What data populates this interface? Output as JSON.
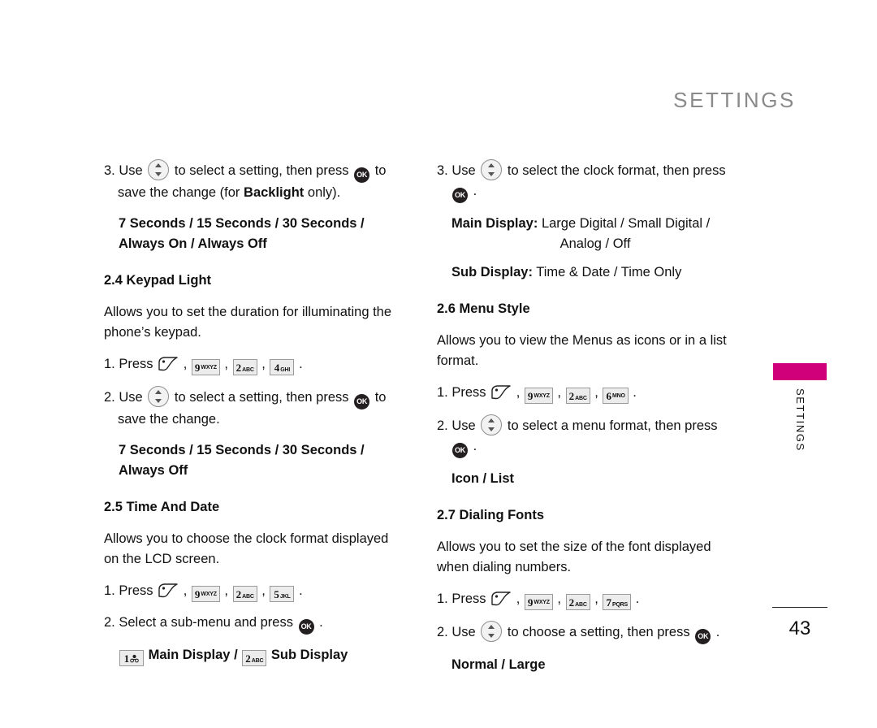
{
  "header": {
    "title": "SETTINGS"
  },
  "side_tab": {
    "label": "SETTINGS",
    "color": "#cf0079"
  },
  "footer": {
    "page_number": "43"
  },
  "icons": {
    "nav_key": "up-down-navigation-key-icon",
    "ok_key": "ok-key-icon",
    "smart_key": "smart-send-key-icon",
    "key_1": "keypad-1-voicemail-key-icon",
    "key_2": "keypad-2-abc-key-icon",
    "key_4": "keypad-4-ghi-key-icon",
    "key_5": "keypad-5-jkl-key-icon",
    "key_6": "keypad-6-mno-key-icon",
    "key_7": "keypad-7-pqrs-key-icon",
    "key_9": "keypad-9-wxyz-key-icon",
    "ok_label": "OK"
  },
  "keys": {
    "k1": {
      "num": "1",
      "sub": ""
    },
    "k2": {
      "num": "2",
      "sub": "ABC"
    },
    "k4": {
      "num": "4",
      "sub": "GHI"
    },
    "k5": {
      "num": "5",
      "sub": "JKL"
    },
    "k6": {
      "num": "6",
      "sub": "MNO"
    },
    "k7": {
      "num": "7",
      "sub": "PQRS"
    },
    "k9": {
      "num": "9",
      "sub": "WXYZ"
    }
  },
  "left_column": {
    "step3_a": "3. Use",
    "step3_b": "to select a setting, then press",
    "step3_c": "to",
    "step3_d": "save the change (for",
    "step3_bold": "Backlight",
    "step3_e": "only).",
    "backlight_options_line1": "7 Seconds / 15 Seconds / 30 Seconds /",
    "backlight_options_line2": "Always On / Always Off",
    "section_24_title": "2.4 Keypad Light",
    "section_24_desc": "Allows you to set the duration for illuminating the phone’s keypad.",
    "s24_step1": "1. Press",
    "s24_step2_a": "2. Use",
    "s24_step2_b": "to select a setting, then press",
    "s24_step2_c": "to",
    "s24_step2_d": "save the change.",
    "keypad_options_line1": "7 Seconds / 15 Seconds / 30 Seconds /",
    "keypad_options_line2": "Always Off",
    "section_25_title": "2.5 Time And Date",
    "section_25_desc": "Allows you to choose the clock format displayed on the LCD screen.",
    "s25_step1": "1. Press",
    "s25_step2_a": "2. Select a sub-menu and press",
    "s25_main_display": "Main Display",
    "s25_slash": "/",
    "s25_sub_display": "Sub Display",
    "period": "."
  },
  "right_column": {
    "step3_a": "3. Use",
    "step3_b": "to select the clock format, then press",
    "main_display_label": "Main Display:",
    "main_display_value_line1": "Large Digital / Small Digital /",
    "main_display_value_line2": "Analog / Off",
    "sub_display_label": "Sub Display:",
    "sub_display_value": "Time & Date / Time Only",
    "section_26_title": "2.6 Menu Style",
    "section_26_desc": "Allows you to view the Menus as icons or in a list format.",
    "s26_step1": "1. Press",
    "s26_step2_a": "2. Use",
    "s26_step2_b": "to select a menu format, then press",
    "s26_options": "Icon / List",
    "section_27_title": "2.7 Dialing Fonts",
    "section_27_desc": "Allows you to set the size of the font displayed when dialing numbers.",
    "s27_step1": "1. Press",
    "s27_step2_a": "2. Use",
    "s27_step2_b": "to choose a setting, then press",
    "s27_options": "Normal / Large",
    "period": ".",
    "comma": ","
  }
}
